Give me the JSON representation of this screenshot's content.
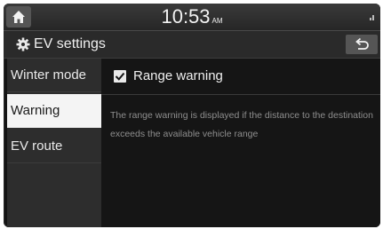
{
  "status_bar": {
    "time": "10:53",
    "ampm": "AM",
    "home_icon": "home-icon",
    "signal_icon": "signal-icon"
  },
  "header": {
    "title": "EV settings",
    "title_icon": "gear-icon",
    "back_icon": "back-arrow-icon"
  },
  "sidebar": {
    "items": [
      {
        "label": "Winter mode",
        "selected": false
      },
      {
        "label": "Warning",
        "selected": true
      },
      {
        "label": "EV route",
        "selected": false
      }
    ]
  },
  "main": {
    "option": {
      "label": "Range warning",
      "checked": true
    },
    "description": "The range warning is displayed if the distance to the destination exceeds the available vehicle range"
  },
  "colors": {
    "background": "#141414",
    "selected_item": "#f4f4f4",
    "button": "#555555"
  }
}
